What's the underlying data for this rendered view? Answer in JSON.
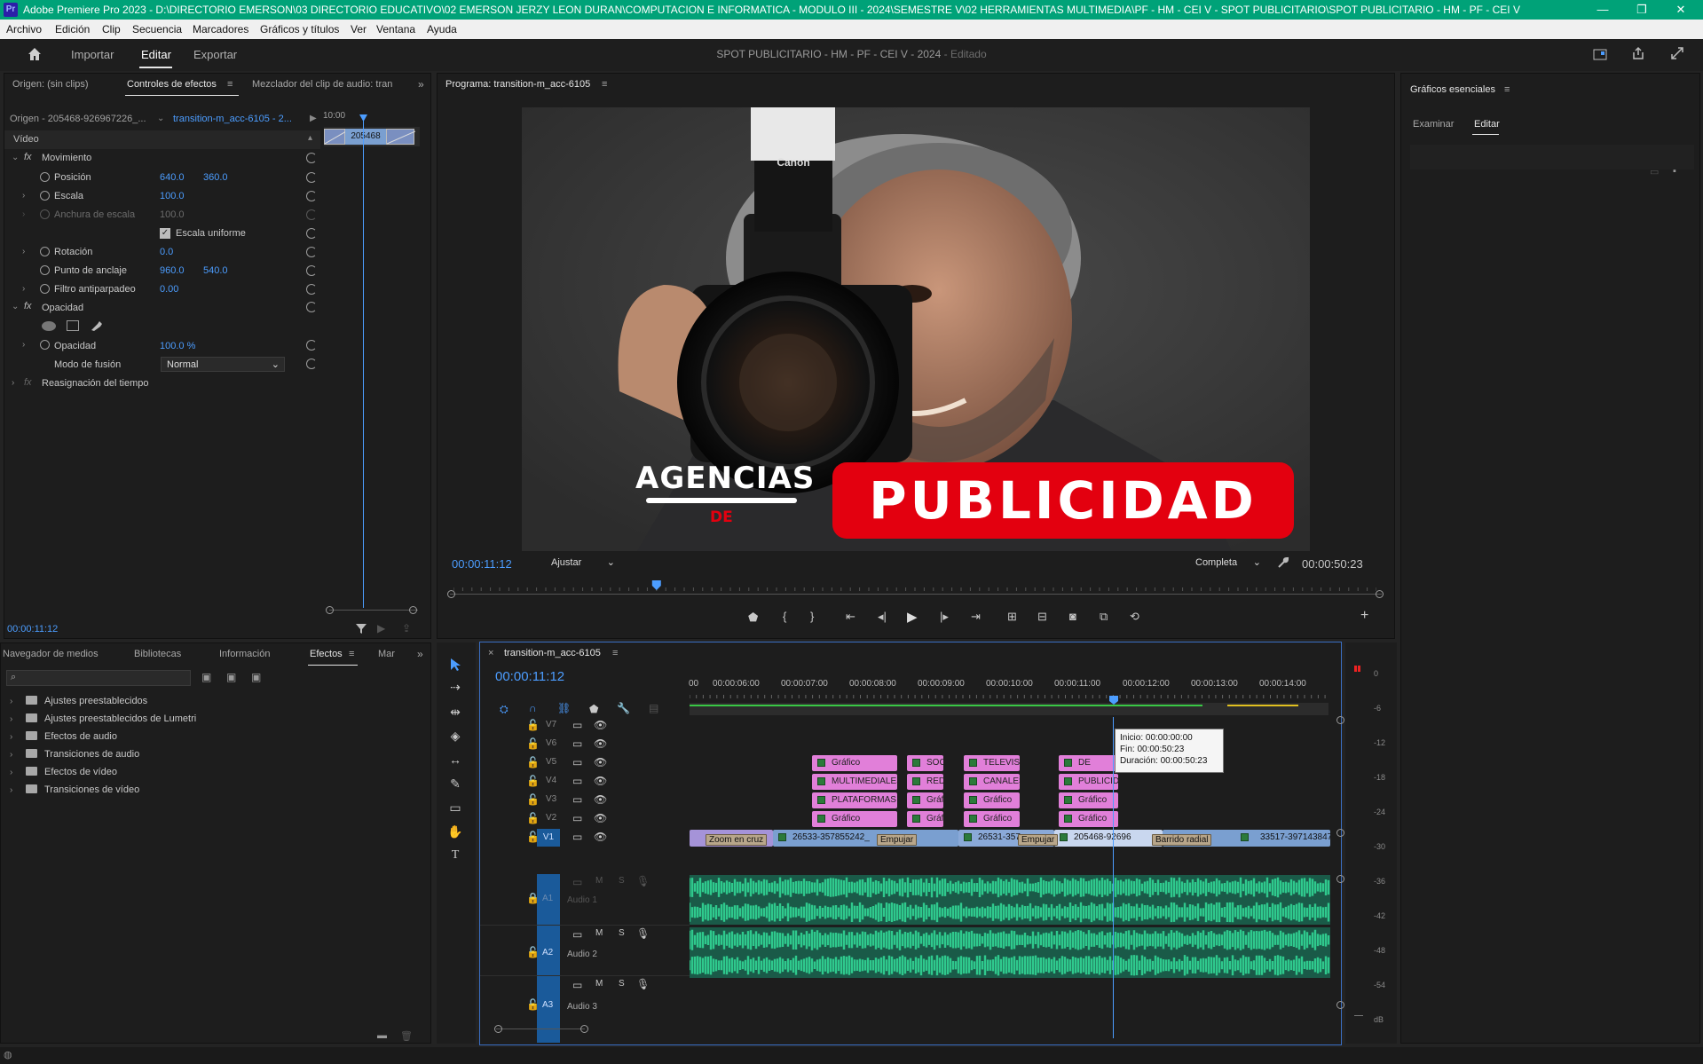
{
  "window": {
    "title": "Adobe Premiere Pro 2023 - D:\\DIRECTORIO EMERSON\\03 DIRECTORIO EDUCATIVO\\02 EMERSON JERZY LEON DURAN\\COMPUTACION E INFORMATICA - MODULO III - 2024\\SEMESTRE V\\02 HERRAMIENTAS MULTIMEDIA\\PF - HM - CEI V - SPOT PUBLICITARIO\\SPOT PUBLICITARIO - HM - PF - CEI V",
    "app_badge": "Pr"
  },
  "menu": [
    "Archivo",
    "Edición",
    "Clip",
    "Secuencia",
    "Marcadores",
    "Gráficos y títulos",
    "Ver",
    "Ventana",
    "Ayuda"
  ],
  "header": {
    "tabs": [
      "Importar",
      "Editar",
      "Exportar"
    ],
    "active_tab": "Editar",
    "project_name": "SPOT PUBLICITARIO - HM - PF - CEI V - 2024",
    "project_state": " - Editado"
  },
  "effect_controls": {
    "tabs": [
      "Origen: (sin clips)",
      "Controles de efectos",
      "Mezclador del clip de audio: tran"
    ],
    "source": "Origen - 205468-926967226_...",
    "sequence": "transition-m_acc-6105 - 2...",
    "ruler_time": "10:00",
    "clip_label": "205468",
    "section": "Vídeo",
    "motion": "Movimiento",
    "position_label": "Posición",
    "position_x": "640.0",
    "position_y": "360.0",
    "scale_label": "Escala",
    "scale": "100.0",
    "scale_width_label": "Anchura de escala",
    "scale_width": "100.0",
    "uniform_label": "Escala uniforme",
    "rotation_label": "Rotación",
    "rotation": "0.0",
    "anchor_label": "Punto de anclaje",
    "anchor_x": "960.0",
    "anchor_y": "540.0",
    "flicker_label": "Filtro antiparpadeo",
    "flicker": "0.00",
    "opacity_section": "Opacidad",
    "opacity_label": "Opacidad",
    "opacity": "100.0 %",
    "blend_label": "Modo de fusión",
    "blend": "Normal",
    "time_remap": "Reasignación del tiempo",
    "timecode": "00:00:11:12"
  },
  "program": {
    "title": "Programa: transition-m_acc-6105",
    "overlay_word1": "AGENCIAS",
    "overlay_word2": "DE",
    "overlay_word3": "PUBLICIDAD",
    "camera_brand": "Canon",
    "current_time": "00:00:11:12",
    "fit": "Ajustar",
    "quality": "Completa",
    "duration": "00:00:50:23",
    "playhead_fraction": 0.22
  },
  "essential_graphics": {
    "title": "Gráficos esenciales",
    "tabs": [
      "Examinar",
      "Editar"
    ],
    "active_tab": "Editar"
  },
  "project_panel": {
    "tabs": [
      "Navegador de medios",
      "Bibliotecas",
      "Información",
      "Efectos",
      "Mar"
    ],
    "active_tab": "Efectos",
    "items": [
      "Ajustes preestablecidos",
      "Ajustes preestablecidos de Lumetri",
      "Efectos de audio",
      "Transiciones de audio",
      "Efectos de vídeo",
      "Transiciones de vídeo"
    ]
  },
  "timeline": {
    "sequence": "transition-m_acc-6105",
    "timecode": "00:00:11:12",
    "ruler": [
      "00:00:06:00",
      "00:00:07:00",
      "00:00:08:00",
      "00:00:09:00",
      "00:00:10:00",
      "00:00:11:00",
      "00:00:12:00",
      "00:00:13:00",
      "00:00:14:00"
    ],
    "ruler_first": "00",
    "tooltip_in": "Inicio: 00:00:00:00",
    "tooltip_out": "Fin: 00:00:50:23",
    "tooltip_dur": "Duración: 00:00:50:23",
    "video_tracks": [
      "V7",
      "V6",
      "V5",
      "V4",
      "V3",
      "V2",
      "V1"
    ],
    "audio_tracks": [
      {
        "id": "A1",
        "name": "Audio 1"
      },
      {
        "id": "A2",
        "name": "Audio 2"
      },
      {
        "id": "A3",
        "name": "Audio 3"
      }
    ],
    "v5": [
      "Gráfico",
      "SOCI",
      "TELEVISIV",
      "DE"
    ],
    "v4": [
      "MULTIMEDIALES",
      "RED",
      "CANALES",
      "PUBLICIDAD"
    ],
    "v3": [
      "PLATAFORMAS",
      "Gráfi",
      "Gráfico",
      "Gráfico"
    ],
    "v2": [
      "Gráfico",
      "Gráfi",
      "Gráfico",
      "Gráfico"
    ],
    "v1": [
      "26533-357855242_",
      "26531-357",
      "205468-92696",
      "33517-397143847"
    ],
    "transitions": [
      "Zoom en cruz",
      "Empujar",
      "Empujar",
      "Barrido radial"
    ],
    "meter_scale": [
      "0",
      "-6",
      "-12",
      "-18",
      "-24",
      "-30",
      "-36",
      "-42",
      "-48",
      "-54",
      "dB"
    ]
  },
  "colors": {
    "accent": "#4c9dff",
    "title_bar": "#00a278",
    "graphic_clip": "#e17fd9",
    "video_clip": "#7a9fd0",
    "audio_wave": "#2fc98d",
    "publicidad_red": "#e3000f"
  }
}
